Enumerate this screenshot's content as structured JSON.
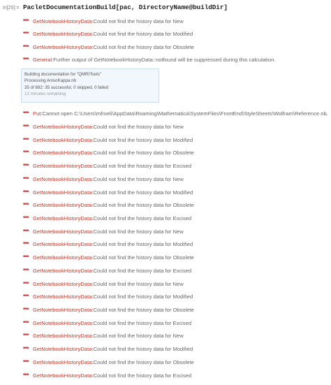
{
  "input": {
    "label": "In[25]:=",
    "code": "PacletDocumentationBuild[pac, DirectoryName@buildDir]"
  },
  "stars": "***",
  "progress": {
    "line1": "Building documentation for \"QMRITools\"",
    "line2": "Processing AnisoKappa.nb",
    "line3": "35 of 692:  35 successful, 0 skipped, 0 failed",
    "line4": "12 minutes remaining"
  },
  "messages": [
    {
      "name": "GetNotebookHistoryData:",
      "text": " Could not find the history data for New"
    },
    {
      "name": "GetNotebookHistoryData:",
      "text": " Could not find the history data for Modified"
    },
    {
      "name": "GetNotebookHistoryData:",
      "text": " Could not find the history data for Obsolete"
    },
    {
      "name": "General:",
      "text": " Further output of GetNotebookHistoryData::notfound will be suppressed during this calculation."
    },
    {
      "name": "Put:",
      "text": " Cannot open C:\\Users\\mfroeli\\AppData\\Roaming\\Mathematica\\SystemFiles\\FrontEnd\\StyleSheets\\Wolfram\\Reference.nb."
    },
    {
      "name": "GetNotebookHistoryData:",
      "text": " Could not find the history data for New"
    },
    {
      "name": "GetNotebookHistoryData:",
      "text": " Could not find the history data for Modified"
    },
    {
      "name": "GetNotebookHistoryData:",
      "text": " Could not find the history data for Obsolete"
    },
    {
      "name": "GetNotebookHistoryData:",
      "text": " Could not find the history data for Excised"
    },
    {
      "name": "GetNotebookHistoryData:",
      "text": " Could not find the history data for New"
    },
    {
      "name": "GetNotebookHistoryData:",
      "text": " Could not find the history data for Modified"
    },
    {
      "name": "GetNotebookHistoryData:",
      "text": " Could not find the history data for Obsolete"
    },
    {
      "name": "GetNotebookHistoryData:",
      "text": " Could not find the history data for Excised"
    },
    {
      "name": "GetNotebookHistoryData:",
      "text": " Could not find the history data for New"
    },
    {
      "name": "GetNotebookHistoryData:",
      "text": " Could not find the history data for Modified"
    },
    {
      "name": "GetNotebookHistoryData:",
      "text": " Could not find the history data for Obsolete"
    },
    {
      "name": "GetNotebookHistoryData:",
      "text": " Could not find the history data for Excised"
    },
    {
      "name": "GetNotebookHistoryData:",
      "text": " Could not find the history data for New"
    },
    {
      "name": "GetNotebookHistoryData:",
      "text": " Could not find the history data for Modified"
    },
    {
      "name": "GetNotebookHistoryData:",
      "text": " Could not find the history data for Obsolete"
    },
    {
      "name": "GetNotebookHistoryData:",
      "text": " Could not find the history data for Excised"
    },
    {
      "name": "GetNotebookHistoryData:",
      "text": " Could not find the history data for New"
    },
    {
      "name": "GetNotebookHistoryData:",
      "text": " Could not find the history data for Modified"
    },
    {
      "name": "GetNotebookHistoryData:",
      "text": " Could not find the history data for Obsolete"
    },
    {
      "name": "GetNotebookHistoryData:",
      "text": " Could not find the history data for Excised"
    }
  ]
}
